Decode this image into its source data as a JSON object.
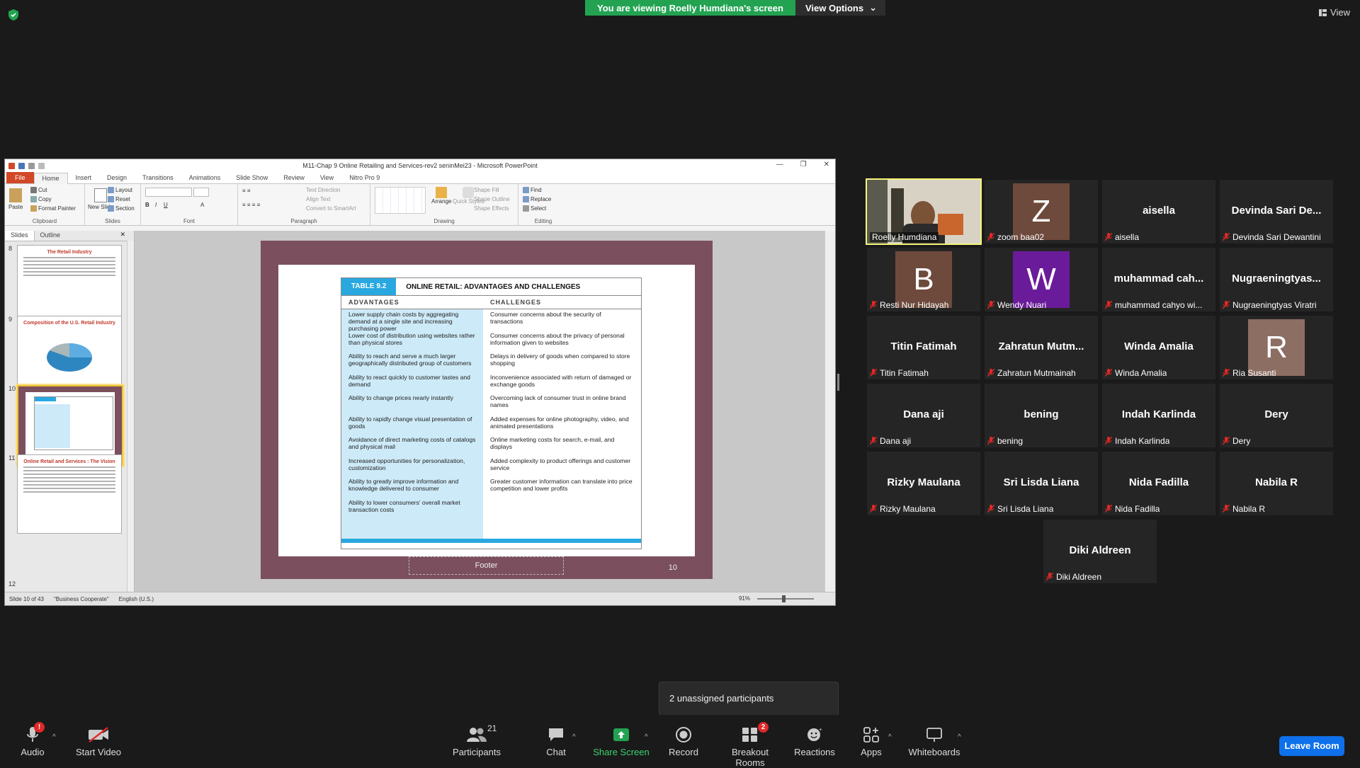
{
  "top_bar": {
    "viewing_text": "You are viewing Roelly Humdiana's screen",
    "view_options_label": "View Options",
    "view_label": "View"
  },
  "ppt": {
    "window_title": "M11-Chap 9 Online Retailing and Services-rev2 seninMei23 - Microsoft PowerPoint",
    "tabs": [
      "File",
      "Home",
      "Insert",
      "Design",
      "Transitions",
      "Animations",
      "Slide Show",
      "Review",
      "View",
      "Nitro Pro 9"
    ],
    "ribbon": {
      "clipboard": {
        "label": "Clipboard",
        "paste": "Paste",
        "cut": "Cut",
        "copy": "Copy",
        "format_painter": "Format Painter"
      },
      "slides": {
        "label": "Slides",
        "new_slide": "New Slide",
        "layout": "Layout",
        "reset": "Reset",
        "section": "Section"
      },
      "font": {
        "label": "Font"
      },
      "paragraph": {
        "label": "Paragraph",
        "text_direction": "Text Direction",
        "align_text": "Align Text",
        "convert_smartart": "Convert to SmartArt"
      },
      "drawing": {
        "label": "Drawing",
        "arrange": "Arrange",
        "quick_styles": "Quick Styles",
        "shape_fill": "Shape Fill",
        "shape_outline": "Shape Outline",
        "shape_effects": "Shape Effects"
      },
      "editing": {
        "label": "Editing",
        "find": "Find",
        "replace": "Replace",
        "select": "Select"
      }
    },
    "pane_tabs": {
      "slides": "Slides",
      "outline": "Outline"
    },
    "thumbnails": [
      {
        "num": "8",
        "title": "The Retail Industry"
      },
      {
        "num": "9",
        "title": "Composition of the U.S. Retail Industry"
      },
      {
        "num": "10",
        "title": "TABLE 9.2"
      },
      {
        "num": "11",
        "title": "Online Retail and Services : The Vision"
      },
      {
        "num": "12",
        "title": ""
      }
    ],
    "slide": {
      "table_label": "TABLE 9.2",
      "table_title": "ONLINE RETAIL: ADVANTAGES AND CHALLENGES",
      "col_advantages": "ADVANTAGES",
      "col_challenges": "CHALLENGES",
      "advantages": [
        "Lower supply chain costs by aggregating demand at a single site and increasing purchasing power",
        "Lower cost of distribution using websites rather than physical stores",
        "Ability to reach and serve a much larger geographically distributed group of customers",
        "Ability to react quickly to customer tastes and demand",
        "Ability to change prices nearly instantly",
        "Ability to rapidly change visual presentation of goods",
        "Avoidance of direct marketing costs of catalogs and physical mail",
        "Increased opportunities for personalization, customization",
        "Ability to greatly improve information and knowledge delivered to consumer",
        "Ability to lower consumers' overall market transaction costs"
      ],
      "challenges": [
        "Consumer concerns about the security of transactions",
        "Consumer concerns about the privacy of personal information given to websites",
        "Delays in delivery of goods when compared to store shopping",
        "Inconvenience associated with return of damaged or exchange goods",
        "Overcoming lack of consumer trust in online brand names",
        "Added expenses for online photography, video, and animated presentations",
        "Online marketing costs for search, e-mail, and displays",
        "Added complexity to product offerings and customer service",
        "Greater customer information can translate into price competition and lower profits",
        ""
      ],
      "footer": "Footer",
      "number": "10"
    },
    "status": {
      "slide_of": "Slide 10 of 43",
      "theme": "\"Business Cooperate\"",
      "language": "English (U.S.)",
      "zoom": "91%"
    }
  },
  "participants": [
    {
      "name": "Roelly Humdiana",
      "display": "",
      "avatar": "",
      "color": "",
      "muted": false,
      "video": true
    },
    {
      "name": "zoom baa02",
      "display": "",
      "avatar": "Z",
      "color": "#6e4a3c",
      "muted": true
    },
    {
      "name": "aisella",
      "display": "aisella",
      "avatar": "",
      "color": "",
      "muted": true
    },
    {
      "name": "Devinda Sari Dewantini",
      "display": "Devinda Sari De...",
      "avatar": "",
      "color": "",
      "muted": true
    },
    {
      "name": "Resti Nur Hidayah",
      "display": "",
      "avatar": "B",
      "color": "#6e4a3c",
      "muted": true
    },
    {
      "name": "Wendy Nuari",
      "display": "",
      "avatar": "W",
      "color": "#6a1b9a",
      "muted": true
    },
    {
      "name": "muhammad cahyo wi...",
      "display": "muhammad cah...",
      "avatar": "",
      "color": "",
      "muted": true
    },
    {
      "name": "Nugraeningtyas Viratri",
      "display": "Nugraeningtyas...",
      "avatar": "",
      "color": "",
      "muted": true
    },
    {
      "name": "Titin Fatimah",
      "display": "Titin Fatimah",
      "avatar": "",
      "color": "",
      "muted": true
    },
    {
      "name": "Zahratun Mutmainah",
      "display": "Zahratun Mutm...",
      "avatar": "",
      "color": "",
      "muted": true
    },
    {
      "name": "Winda Amalia",
      "display": "Winda Amalia",
      "avatar": "",
      "color": "",
      "muted": true
    },
    {
      "name": "Ria Susanti",
      "display": "",
      "avatar": "R",
      "color": "#8d6e63",
      "muted": true
    },
    {
      "name": "Dana aji",
      "display": "Dana aji",
      "avatar": "",
      "color": "",
      "muted": true
    },
    {
      "name": "bening",
      "display": "bening",
      "avatar": "",
      "color": "",
      "muted": true
    },
    {
      "name": "Indah Karlinda",
      "display": "Indah Karlinda",
      "avatar": "",
      "color": "",
      "muted": true
    },
    {
      "name": "Dery",
      "display": "Dery",
      "avatar": "",
      "color": "",
      "muted": true
    },
    {
      "name": "Rizky Maulana",
      "display": "Rizky Maulana",
      "avatar": "",
      "color": "",
      "muted": true
    },
    {
      "name": "Sri Lisda Liana",
      "display": "Sri Lisda Liana",
      "avatar": "",
      "color": "",
      "muted": true
    },
    {
      "name": "Nida Fadilla",
      "display": "Nida Fadilla",
      "avatar": "",
      "color": "",
      "muted": true
    },
    {
      "name": "Nabila R",
      "display": "Nabila R",
      "avatar": "",
      "color": "",
      "muted": true
    },
    {
      "name": "Diki Aldreen",
      "display": "Diki Aldreen",
      "avatar": "",
      "color": "",
      "muted": true
    }
  ],
  "tooltip": {
    "unassigned": "2 unassigned participants"
  },
  "toolbar": {
    "audio": "Audio",
    "audio_badge": "!",
    "start_video": "Start Video",
    "participants": "Participants",
    "participants_count": "21",
    "chat": "Chat",
    "share_screen": "Share Screen",
    "record": "Record",
    "breakout_rooms": "Breakout Rooms",
    "breakout_badge": "2",
    "reactions": "Reactions",
    "apps": "Apps",
    "whiteboards": "Whiteboards",
    "leave_room": "Leave Room"
  },
  "colors": {
    "share_green": "#23a352",
    "active_speaker": "#f5f57a",
    "leave_blue": "#0e71eb",
    "table_blue": "#29a8e0",
    "slide_bg": "#7b4f5e"
  }
}
